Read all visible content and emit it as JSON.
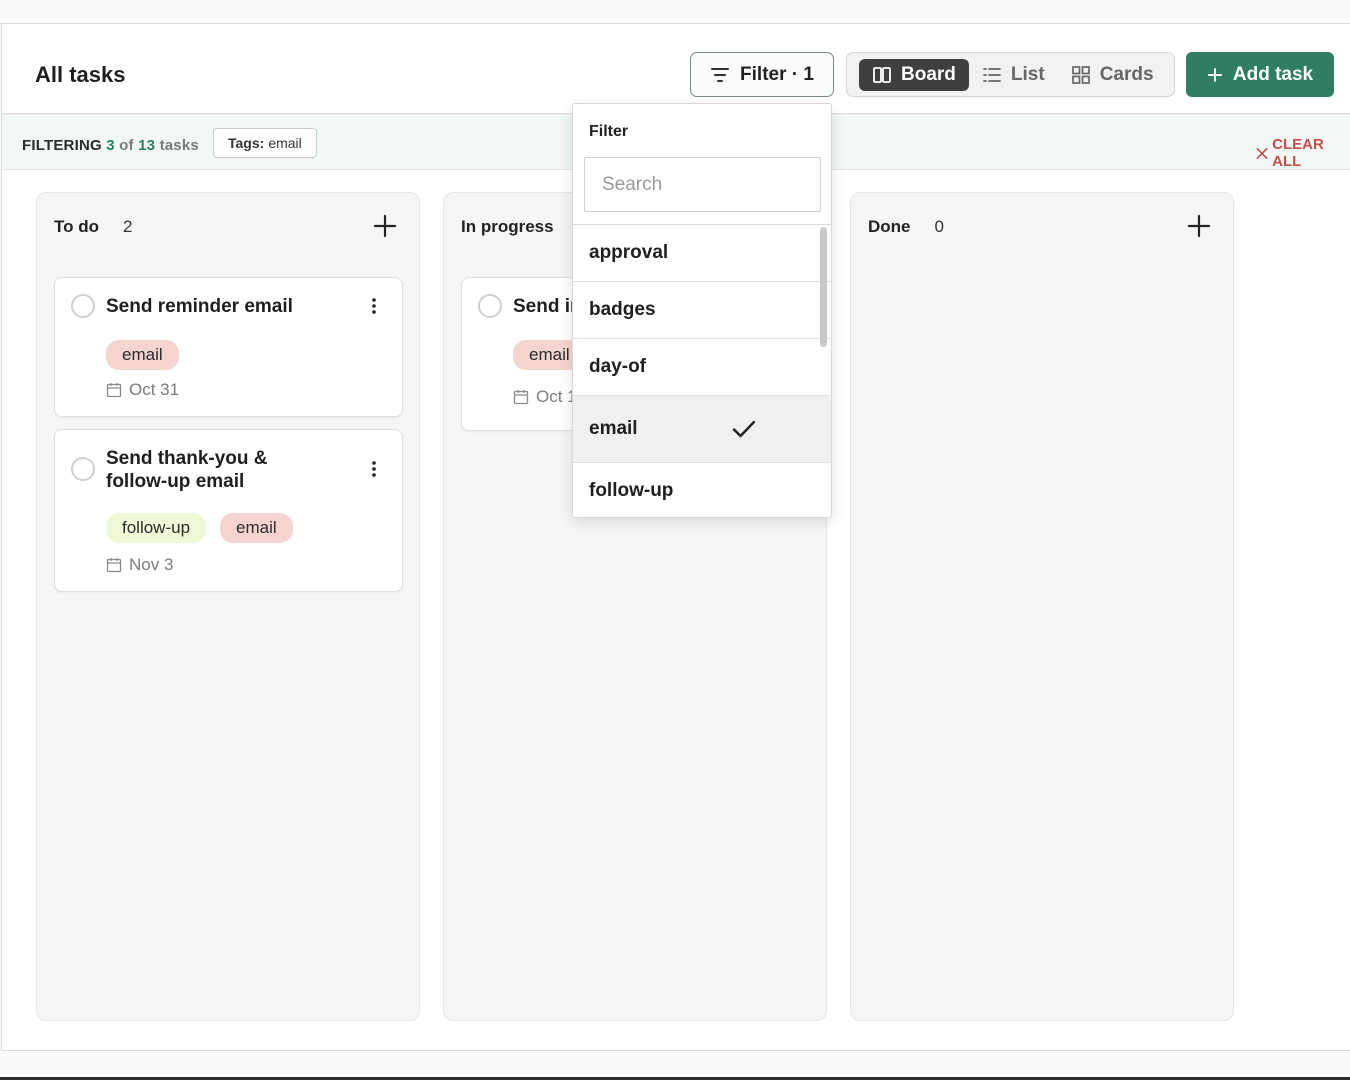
{
  "header": {
    "title": "All tasks",
    "filter_label": "Filter · 1",
    "views": [
      {
        "label": "Board",
        "active": true,
        "icon": "board-icon"
      },
      {
        "label": "List",
        "active": false,
        "icon": "list-icon"
      },
      {
        "label": "Cards",
        "active": false,
        "icon": "cards-icon"
      }
    ],
    "add_task_label": "Add task"
  },
  "filter_bar": {
    "prefix": "FILTERING",
    "shown": "3",
    "of": "of",
    "total": "13",
    "suffix": "tasks",
    "chip_key": "Tags:",
    "chip_value": "email",
    "clear_label": "CLEAR ALL"
  },
  "columns": [
    {
      "name": "To do",
      "count": "2",
      "cards": [
        {
          "title": "Send reminder email",
          "tags": [
            "email"
          ],
          "due": "Oct 31"
        },
        {
          "title": "Send thank-you & follow-up email",
          "tags": [
            "follow-up",
            "email"
          ],
          "due": "Nov 3"
        }
      ]
    },
    {
      "name": "In progress",
      "count": "",
      "cards": [
        {
          "title": "Send ir",
          "tags": [
            "email"
          ],
          "due": "Oct 1"
        }
      ]
    },
    {
      "name": "Done",
      "count": "0",
      "cards": []
    }
  ],
  "dropdown": {
    "title": "Filter",
    "search_placeholder": "Search",
    "options": [
      "approval",
      "badges",
      "day-of",
      "email",
      "follow-up"
    ],
    "selected": "email"
  },
  "colors": {
    "accent": "#2f7d62",
    "clear": "#c0504d",
    "tag_email": "#f5d4d0",
    "tag_followup": "#eef9d6"
  }
}
